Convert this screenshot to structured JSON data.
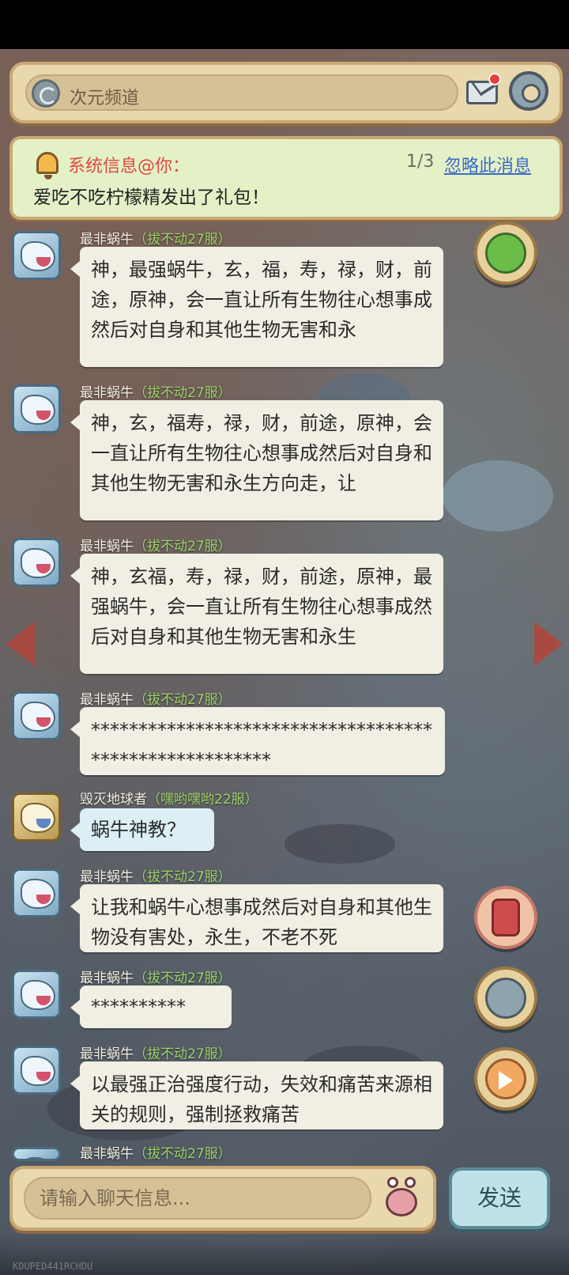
{
  "header": {
    "channel_label": "次元频道"
  },
  "system_notice": {
    "title": "系统信息@你：",
    "count": "1/3",
    "ignore_label": "忽略此消息",
    "text": "爱吃不吃柠檬精发出了礼包！"
  },
  "messages": [
    {
      "sender": "最非蜗牛",
      "server": "（拔不动27服）",
      "text": "神，最强蜗牛，玄，福，寿，禄，财，前途，原神，会一直让所有生物往心想事成然后对自身和其他生物无害和永"
    },
    {
      "sender": "最非蜗牛",
      "server": "（拔不动27服）",
      "text": "神，玄，福寿，禄，财，前途，原神，会一直让所有生物往心想事成然后对自身和其他生物无害和永生方向走，让"
    },
    {
      "sender": "最非蜗牛",
      "server": "（拔不动27服）",
      "text": "神，玄福，寿，禄，财，前途，原神，最强蜗牛，会一直让所有生物往心想事成然后对自身和其他生物无害和永生"
    },
    {
      "sender": "最非蜗牛",
      "server": "（拔不动27服）",
      "text": "*******************************************************"
    },
    {
      "sender": "毁灭地球者",
      "server": "（嘿哟嘿哟22服）",
      "text": "蜗牛神教？"
    },
    {
      "sender": "最非蜗牛",
      "server": "（拔不动27服）",
      "text": "让我和蜗牛心想事成然后对自身和其他生物没有害处，永生，不老不死"
    },
    {
      "sender": "最非蜗牛",
      "server": "（拔不动27服）",
      "text": "**********"
    },
    {
      "sender": "最非蜗牛",
      "server": "（拔不动27服）",
      "text": "以最强正治强度行动，失效和痛苦来源相关的规则，强制拯救痛苦"
    },
    {
      "sender": "最非蜗牛",
      "server": "（拔不动27服）",
      "text": ""
    }
  ],
  "input": {
    "placeholder": "请输入聊天信息..."
  },
  "send_label": "发送",
  "corner_text": "KDUPED441RCHDU",
  "colors": {
    "panel": "#e9d7ad",
    "panel_border": "#c9a874",
    "notice_bg": "#e4f1c7",
    "notice_title": "#e0463d",
    "link": "#3b6bc4",
    "server_tag": "#9ed36a",
    "bubble": "#f1efe3",
    "bubble_alt": "#dbeff5",
    "send_button": "#bfe2ea"
  },
  "icons": [
    "channel-icon",
    "mail-icon",
    "gear-icon",
    "bell-icon",
    "wechat-icon",
    "red-packet-icon",
    "refresh-icon",
    "arrow-right-icon",
    "emoji-icon"
  ]
}
